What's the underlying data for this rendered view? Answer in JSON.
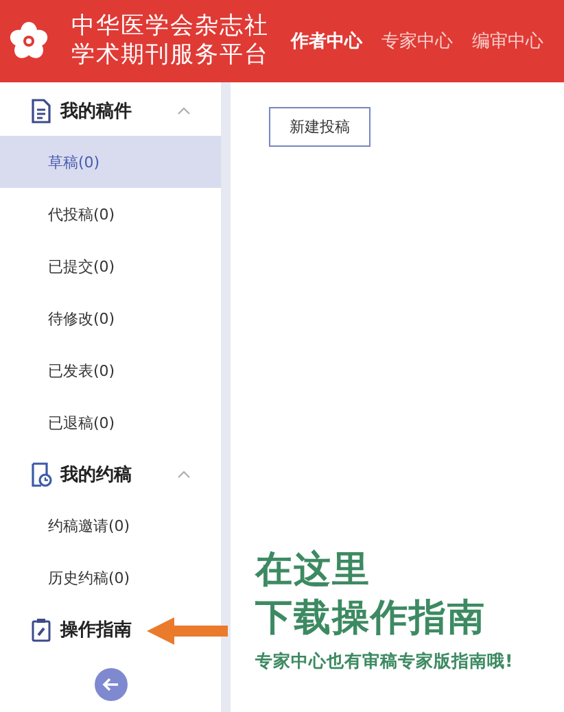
{
  "header": {
    "title_lines": [
      "中华医学会杂志社",
      "学术期刊服务平台"
    ],
    "nav": [
      {
        "label": "作者中心",
        "selected": true
      },
      {
        "label": "专家中心",
        "selected": false
      },
      {
        "label": "编审中心",
        "selected": false
      }
    ]
  },
  "sidebar": {
    "groups": [
      {
        "label": "我的稿件",
        "expanded": true,
        "children": [
          {
            "label": "草稿(0)",
            "selected": true
          },
          {
            "label": "代投稿(0)",
            "selected": false
          },
          {
            "label": "已提交(0)",
            "selected": false
          },
          {
            "label": "待修改(0)",
            "selected": false
          },
          {
            "label": "已发表(0)",
            "selected": false
          },
          {
            "label": "已退稿(0)",
            "selected": false
          }
        ]
      },
      {
        "label": "我的约稿",
        "expanded": true,
        "children": [
          {
            "label": "约稿邀请(0)",
            "selected": false
          },
          {
            "label": "历史约稿(0)",
            "selected": false
          }
        ]
      }
    ],
    "guide": {
      "label": "操作指南"
    }
  },
  "main": {
    "new_button": "新建投稿"
  },
  "annotation": {
    "lines": [
      "在这里",
      "下载操作指南"
    ],
    "note": "专家中心也有审稿专家版指南哦!"
  }
}
